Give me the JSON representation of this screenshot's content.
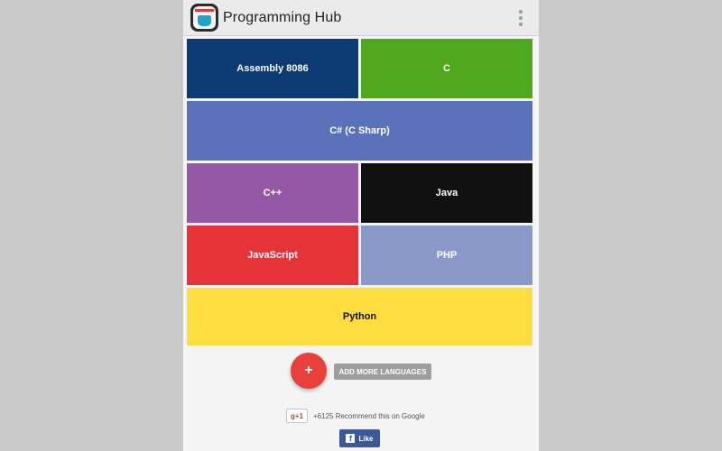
{
  "appbar": {
    "title": "Programming Hub",
    "logo_icon": "programming-hub-logo",
    "menu_icon": "more-vert-icon"
  },
  "languages": [
    {
      "label": "Assembly 8086",
      "color": "#0d3a73"
    },
    {
      "label": "C",
      "color": "#4fa81e"
    },
    {
      "label": "C# (C Sharp)",
      "color": "#5b72ba"
    },
    {
      "label": "C++",
      "color": "#9458a6"
    },
    {
      "label": "Java",
      "color": "#111111"
    },
    {
      "label": "JavaScript",
      "color": "#e6333a"
    },
    {
      "label": "PHP",
      "color": "#8a9ac8"
    },
    {
      "label": "Python",
      "color": "#ffdc40"
    }
  ],
  "actions": {
    "fab_label": "+",
    "add_more_label": "ADD MORE LANGUAGES"
  },
  "social": {
    "gplus_label": "g+1",
    "gplus_text": "+6125 Recommend this on Google",
    "fb_icon": "f",
    "fb_like_label": "Like"
  }
}
